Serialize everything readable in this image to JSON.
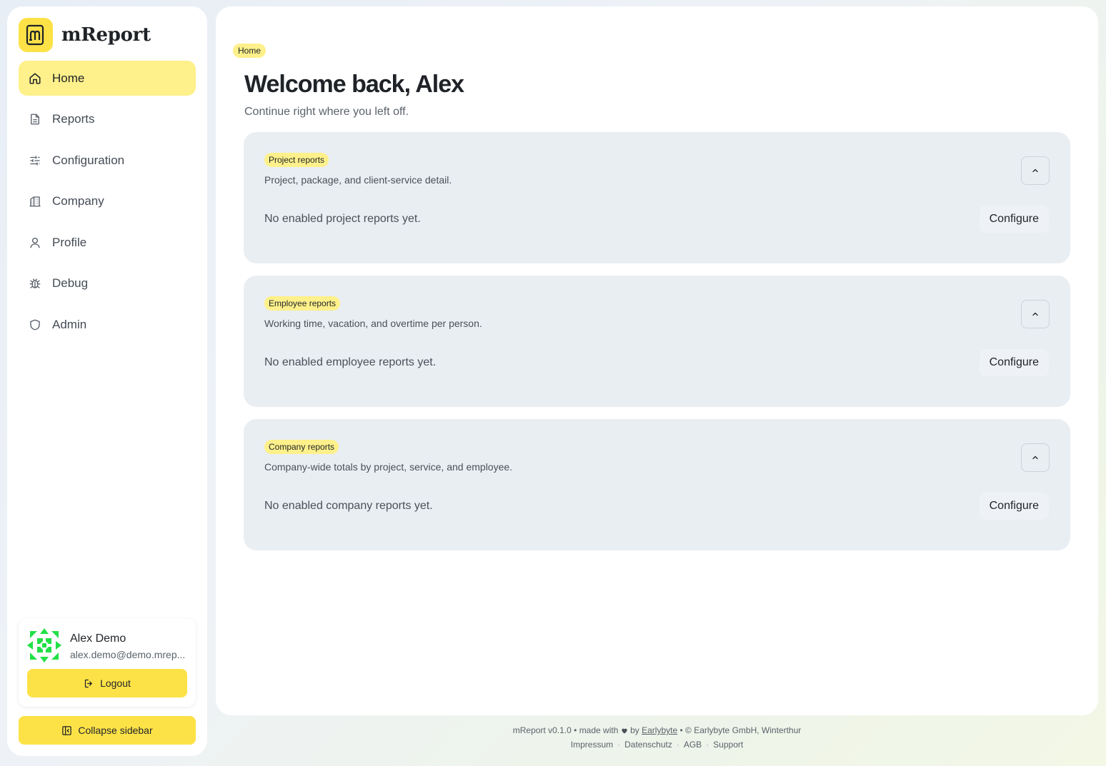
{
  "brand": {
    "name": "mReport"
  },
  "sidebar": {
    "items": [
      {
        "label": "Home",
        "icon": "home-icon",
        "active": true
      },
      {
        "label": "Reports",
        "icon": "document-icon"
      },
      {
        "label": "Configuration",
        "icon": "sliders-icon"
      },
      {
        "label": "Company",
        "icon": "building-icon"
      },
      {
        "label": "Profile",
        "icon": "user-icon"
      },
      {
        "label": "Debug",
        "icon": "bug-icon"
      },
      {
        "label": "Admin",
        "icon": "shield-icon"
      }
    ],
    "user": {
      "name": "Alex Demo",
      "email": "alex.demo@demo.mrep...",
      "logout_label": "Logout"
    },
    "collapse_label": "Collapse sidebar"
  },
  "main": {
    "breadcrumb": "Home",
    "title": "Welcome back, Alex",
    "subtitle": "Continue right where you left off.",
    "cards": [
      {
        "badge": "Project reports",
        "description": "Project, package, and client-service detail.",
        "empty": "No enabled project reports yet.",
        "action": "Configure"
      },
      {
        "badge": "Employee reports",
        "description": "Working time, vacation, and overtime per person.",
        "empty": "No enabled employee reports yet.",
        "action": "Configure"
      },
      {
        "badge": "Company reports",
        "description": "Company-wide totals by project, service, and employee.",
        "empty": "No enabled company reports yet.",
        "action": "Configure"
      }
    ]
  },
  "footer": {
    "version": "mReport v0.1.0",
    "made_with": "made with",
    "by": "by",
    "company_link": "Earlybyte",
    "copyright": "© Earlybyte GmbH, Winterthur",
    "links": [
      "Impressum",
      "Datenschutz",
      "AGB",
      "Support"
    ]
  },
  "colors": {
    "accent": "#fde247",
    "accent_soft": "#fef08a",
    "card_bg": "#e9eef3",
    "avatar": "#22e047"
  }
}
